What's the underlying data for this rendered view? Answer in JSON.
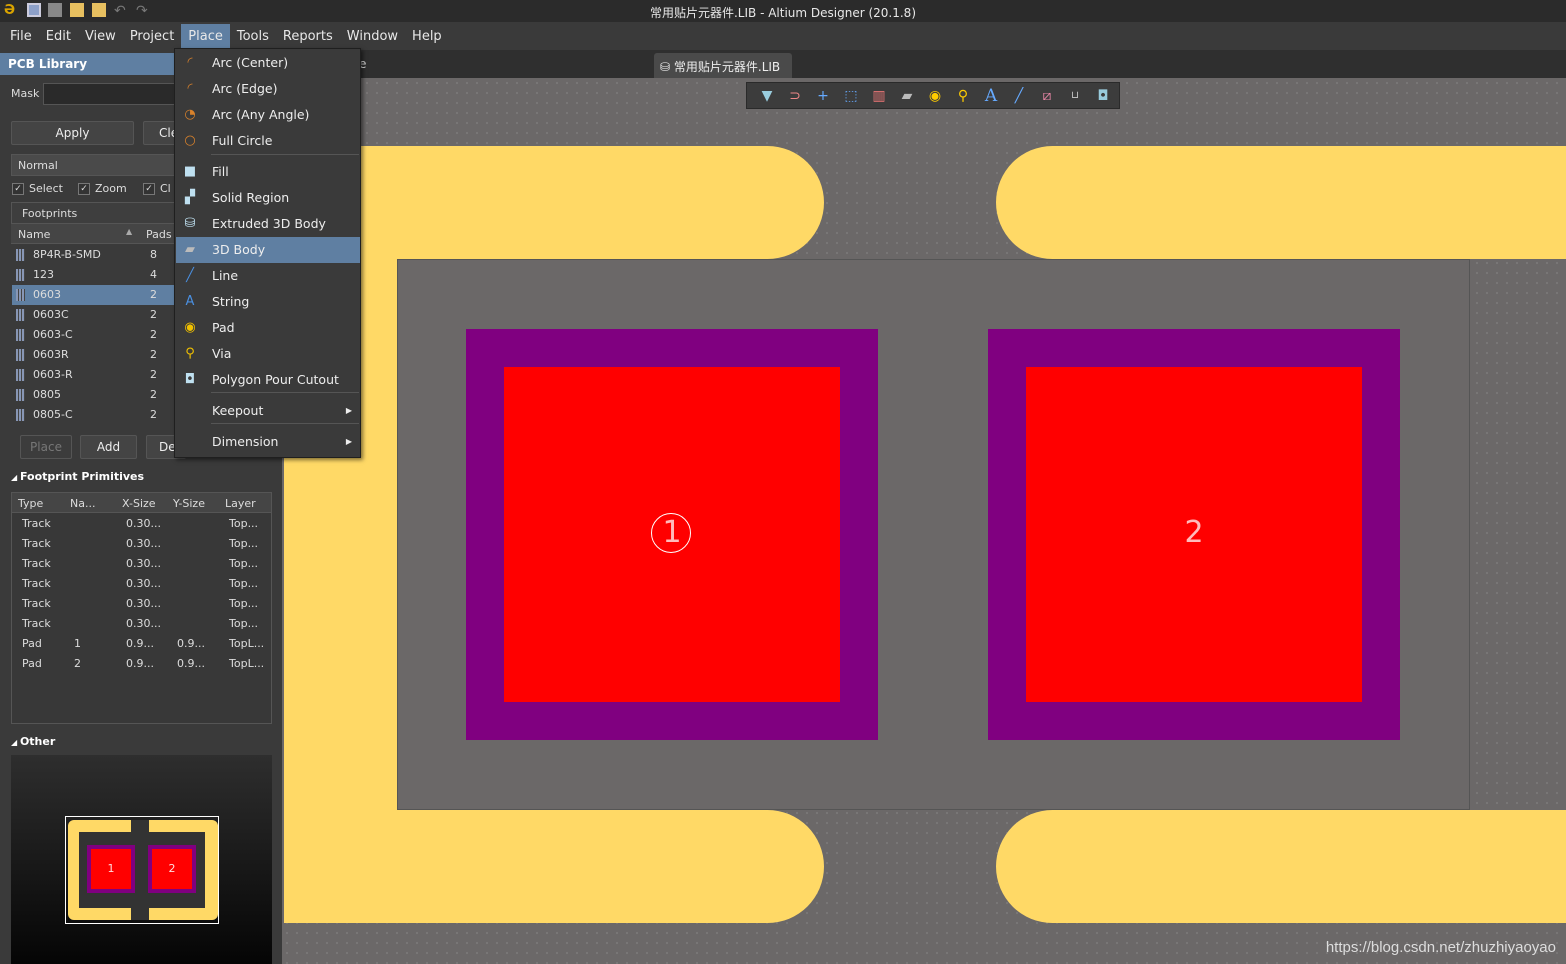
{
  "window": {
    "title": "常用贴片元器件.LIB - Altium Designer (20.1.8)"
  },
  "menubar": [
    "File",
    "Edit",
    "View",
    "Project",
    "Place",
    "Tools",
    "Reports",
    "Window",
    "Help"
  ],
  "panel": {
    "title": "PCB Library",
    "mask_label": "Mask",
    "mask_value": "",
    "apply": "Apply",
    "clear": "Cle",
    "mode": "Normal",
    "checks": [
      "Select",
      "Zoom",
      "Cl"
    ],
    "footprints_label": "Footprints",
    "col_name": "Name",
    "col_pads": "Pads",
    "footprints": [
      {
        "name": "8P4R-B-SMD",
        "pads": "8"
      },
      {
        "name": "123",
        "pads": "4"
      },
      {
        "name": "0603",
        "pads": "2"
      },
      {
        "name": "0603C",
        "pads": "2"
      },
      {
        "name": "0603-C",
        "pads": "2"
      },
      {
        "name": "0603R",
        "pads": "2"
      },
      {
        "name": "0603-R",
        "pads": "2"
      },
      {
        "name": "0805",
        "pads": "2"
      },
      {
        "name": "0805-C",
        "pads": "2"
      }
    ],
    "place": "Place",
    "add": "Add",
    "delete": "Del",
    "primitives_label": "Footprint Primitives",
    "prim_cols": [
      "Type",
      "Na...",
      "X-Size",
      "Y-Size",
      "Layer"
    ],
    "primitives": [
      [
        "Track",
        "",
        "0.30...",
        "",
        "Top..."
      ],
      [
        "Track",
        "",
        "0.30...",
        "",
        "Top..."
      ],
      [
        "Track",
        "",
        "0.30...",
        "",
        "Top..."
      ],
      [
        "Track",
        "",
        "0.30...",
        "",
        "Top..."
      ],
      [
        "Track",
        "",
        "0.30...",
        "",
        "Top..."
      ],
      [
        "Track",
        "",
        "0.30...",
        "",
        "Top..."
      ],
      [
        "Pad",
        "1",
        "0.9...",
        "0.9...",
        "TopL..."
      ],
      [
        "Pad",
        "2",
        "0.9...",
        "0.9...",
        "TopL..."
      ]
    ],
    "other_label": "Other",
    "preview_pads": [
      "1",
      "2"
    ]
  },
  "tab": {
    "partial": "e",
    "label": "常用贴片元器件.LIB"
  },
  "place_menu": [
    {
      "label": "Arc (Center)",
      "icon": "arc-center-icon"
    },
    {
      "label": "Arc (Edge)",
      "icon": "arc-edge-icon"
    },
    {
      "label": "Arc (Any Angle)",
      "icon": "arc-any-icon"
    },
    {
      "label": "Full Circle",
      "icon": "circle-icon"
    },
    {
      "label": "Fill",
      "icon": "fill-icon"
    },
    {
      "label": "Solid Region",
      "icon": "region-icon"
    },
    {
      "label": "Extruded 3D Body",
      "icon": "extruded-icon"
    },
    {
      "label": "3D Body",
      "icon": "3d-body-icon"
    },
    {
      "label": "Line",
      "icon": "line-icon"
    },
    {
      "label": "String",
      "icon": "string-icon"
    },
    {
      "label": "Pad",
      "icon": "pad-icon"
    },
    {
      "label": "Via",
      "icon": "via-icon"
    },
    {
      "label": "Polygon Pour Cutout",
      "icon": "polygon-cutout-icon"
    },
    {
      "label": "Keepout",
      "icon": ""
    },
    {
      "label": "Dimension",
      "icon": ""
    }
  ],
  "canvas": {
    "pad1": "1",
    "pad2": "2",
    "colors": {
      "silk": "#ffd966",
      "pad_mask": "#800080",
      "pad": "#ff0000",
      "body": "#6b6868"
    }
  },
  "watermark": "https://blog.csdn.net/zhuzhiyaoyao"
}
